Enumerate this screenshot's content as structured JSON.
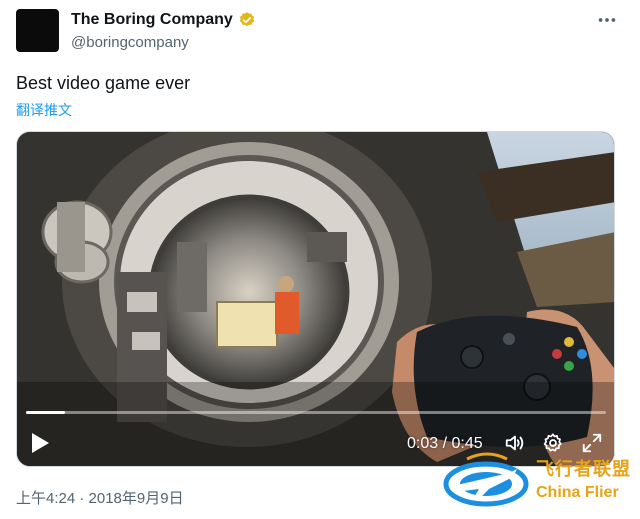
{
  "account": {
    "name": "The Boring Company",
    "handle": "@boringcompany",
    "verified_color": "#e2b719"
  },
  "tweet": {
    "text": "Best video game ever",
    "translate_label": "翻译推文",
    "timestamp": "上午4:24 · 2018年9月9日"
  },
  "video": {
    "current_time": "0:03",
    "separator": " / ",
    "duration": "0:45",
    "progress": 0.067,
    "icons": [
      "play-icon",
      "volume-icon",
      "settings-icon",
      "fullscreen-icon"
    ]
  },
  "watermark": {
    "cn_text": "飞行者联盟",
    "en_text": "China Flier"
  },
  "colors": {
    "link": "#1d9bf0",
    "secondary": "#536471",
    "watermark": "#e8a318"
  }
}
